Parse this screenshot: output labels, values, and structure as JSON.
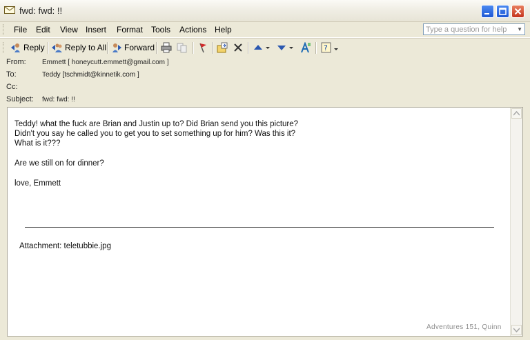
{
  "window": {
    "title": "fwd: fwd: !!",
    "icon": "envelope-icon",
    "controls": [
      "minimize-icon",
      "maximize-icon",
      "close-icon"
    ]
  },
  "menu": {
    "file": "File",
    "edit": "Edit",
    "view": "View",
    "insert": "Insert",
    "format": "Format",
    "tools": "Tools",
    "actions": "Actions",
    "help": "Help"
  },
  "help_search": {
    "placeholder": "Type a question for help"
  },
  "toolbar": {
    "reply": "Reply",
    "reply_all": "Reply to All",
    "forward": "Forward",
    "icons": [
      "print-icon",
      "copy-icon",
      "flag-icon",
      "move-to-folder-icon",
      "delete-icon",
      "previous-item-icon",
      "next-item-icon",
      "address-book-icon",
      "help-icon"
    ]
  },
  "header": {
    "from_label": "From:",
    "from_value": "Emmett [ honeycutt.emmett@gmail.com ]",
    "to_label": "To:",
    "to_value": "Teddy [tschmidt@kinnetik.com ]",
    "cc_label": "Cc:",
    "cc_value": "",
    "subject_label": "Subject:",
    "subject_value": "fwd: fwd: !!"
  },
  "message": {
    "lines": [
      "Teddy! what the fuck are Brian and Justin up to? Did Brian send you this picture?",
      "Didn't you say he called you to get you to set something up for him? Was this it?",
      "What is it???",
      "Are we still on for dinner?",
      "love, Emmett"
    ],
    "attachment": "Attachment: teletubbie.jpg",
    "credit": "Adventures 151, Quinn"
  },
  "colors": {
    "chrome": "#ece9d8",
    "close_button": "#c5341d",
    "window_button": "#1d57d4"
  }
}
